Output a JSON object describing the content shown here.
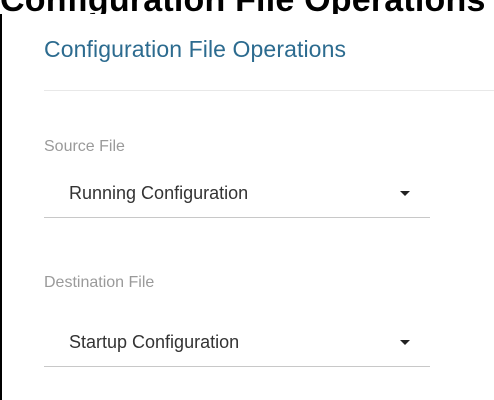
{
  "top_heading": "Configuration File Operations",
  "panel": {
    "title": "Configuration File Operations"
  },
  "source_file": {
    "label": "Source File",
    "selected_value": "Running Configuration"
  },
  "destination_file": {
    "label": "Destination File",
    "selected_value": "Startup Configuration"
  },
  "icons": {
    "dropdown": "chevron-down-icon"
  },
  "colors": {
    "title": "#2c6b8f",
    "label": "#9a9a9a",
    "value": "#333333",
    "divider": "#c8c8c8"
  }
}
